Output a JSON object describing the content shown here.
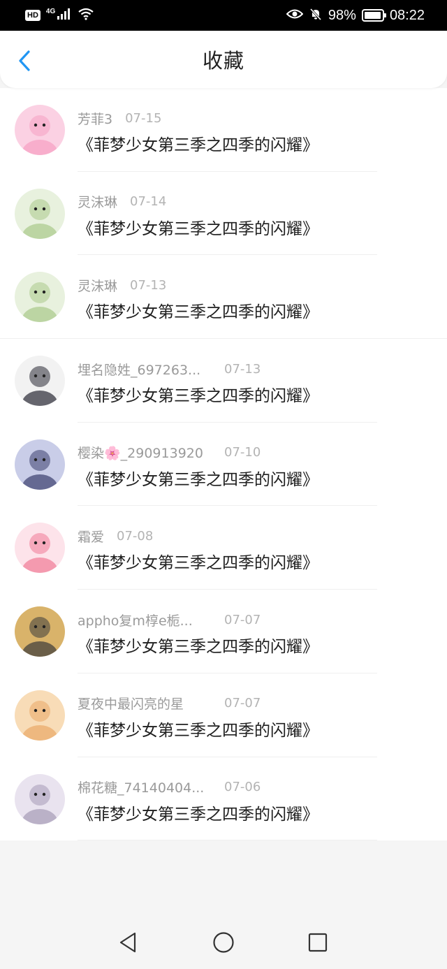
{
  "status_bar": {
    "hd_badge": "HD",
    "network": "4G",
    "battery_text": "98%",
    "battery_level": 0.98,
    "time": "08:22",
    "icons": [
      "signal-icon",
      "wifi-icon",
      "eye-icon",
      "mute-bell-icon",
      "battery-icon"
    ]
  },
  "header": {
    "title": "收藏",
    "back_icon": "chevron-left-icon",
    "accent_color": "#2196f3"
  },
  "items": [
    {
      "username": "芳菲3",
      "date": "07-15",
      "title": "《菲梦少女第三季之四季的闪耀》",
      "avatar_colors": [
        "#fbd1e3",
        "#f6a0c2"
      ]
    },
    {
      "username": "灵沫琳",
      "date": "07-14",
      "title": "《菲梦少女第三季之四季的闪耀》",
      "avatar_colors": [
        "#e8f1de",
        "#a9c98a"
      ]
    },
    {
      "username": "灵沫琳",
      "date": "07-13",
      "title": "《菲梦少女第三季之四季的闪耀》",
      "avatar_colors": [
        "#e8f1de",
        "#a9c98a"
      ]
    },
    {
      "username": "埋名隐姓_697263...",
      "date": "07-13",
      "title": "《菲梦少女第三季之四季的闪耀》",
      "avatar_colors": [
        "#f2f2f2",
        "#2a2a35"
      ]
    },
    {
      "username": "樱染🌸_290913920",
      "date": "07-10",
      "title": "《菲梦少女第三季之四季的闪耀》",
      "avatar_colors": [
        "#c9cde8",
        "#3a3f6e"
      ]
    },
    {
      "username": "霜爱",
      "date": "07-08",
      "title": "《菲梦少女第三季之四季的闪耀》",
      "avatar_colors": [
        "#fde3ea",
        "#f07a96"
      ]
    },
    {
      "username": "appho复m椁e栀...",
      "date": "07-07",
      "title": "《菲梦少女第三季之四季的闪耀》",
      "avatar_colors": [
        "#d9b36a",
        "#3a3a3a"
      ]
    },
    {
      "username": "夏夜中最闪亮的星",
      "date": "07-07",
      "title": "《菲梦少女第三季之四季的闪耀》",
      "avatar_colors": [
        "#f8dcb7",
        "#e9a866"
      ]
    },
    {
      "username": "棉花糖_74140404...",
      "date": "07-06",
      "title": "《菲梦少女第三季之四季的闪耀》",
      "avatar_colors": [
        "#e9e3ef",
        "#a59bb6"
      ]
    }
  ],
  "nav_bar": {
    "icons": [
      "back-triangle-icon",
      "home-circle-icon",
      "recents-square-icon"
    ]
  }
}
